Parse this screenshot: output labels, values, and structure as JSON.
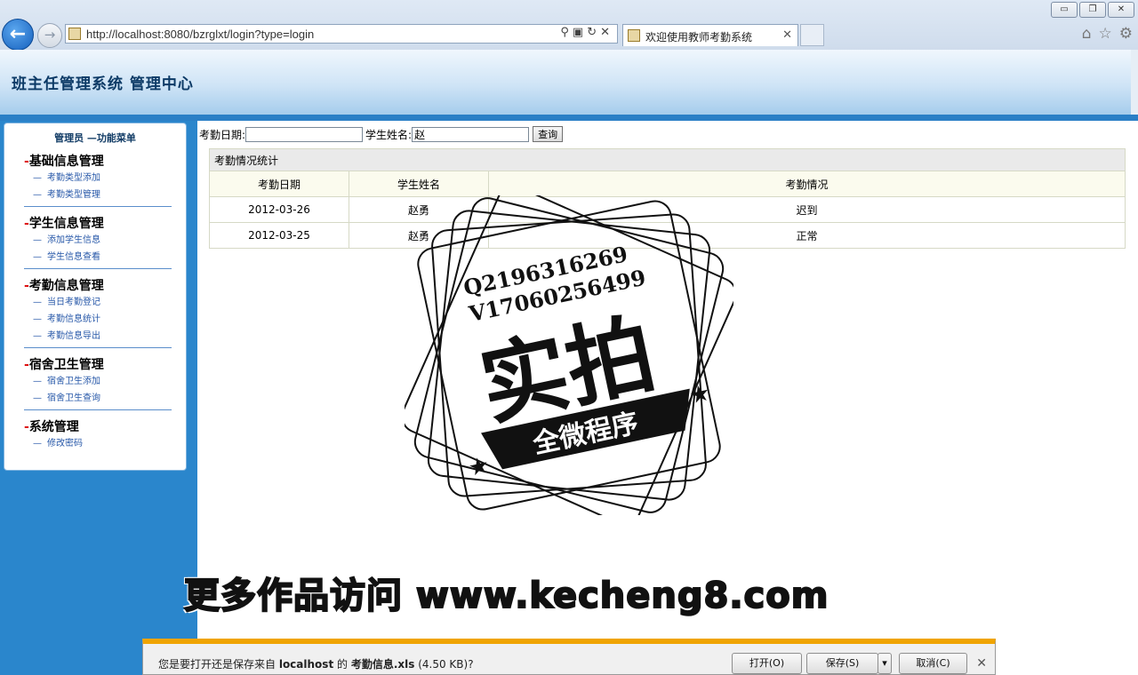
{
  "browser": {
    "url": "http://localhost:8080/bzrglxt/login?type=login",
    "tab_title": "欢迎使用教师考勤系统",
    "window_buttons": [
      "▭",
      "❐",
      "✕"
    ]
  },
  "page": {
    "header_title": "班主任管理系统  管理中心"
  },
  "menu": {
    "heading": "管理员  —功能菜单",
    "groups": [
      {
        "title": "基础信息管理",
        "items": [
          "考勤类型添加",
          "考勤类型管理"
        ]
      },
      {
        "title": "学生信息管理",
        "items": [
          "添加学生信息",
          "学生信息查看"
        ]
      },
      {
        "title": "考勤信息管理",
        "items": [
          "当日考勤登记",
          "考勤信息统计",
          "考勤信息导出"
        ]
      },
      {
        "title": "宿舍卫生管理",
        "items": [
          "宿舍卫生添加",
          "宿舍卫生查询"
        ]
      },
      {
        "title": "系统管理",
        "items": [
          "修改密码"
        ]
      }
    ]
  },
  "search": {
    "date_label": "考勤日期:",
    "date_value": "",
    "name_label": "学生姓名:",
    "name_value": "赵",
    "button_label": "查询"
  },
  "table": {
    "caption": "考勤情况统计",
    "headers": [
      "考勤日期",
      "学生姓名",
      "考勤情况"
    ],
    "rows": [
      [
        "2012-03-26",
        "赵勇",
        "迟到"
      ],
      [
        "2012-03-25",
        "赵勇",
        "正常"
      ]
    ]
  },
  "watermark": {
    "line1": "Q2196316269",
    "line2": "V17060256499",
    "main": "实拍",
    "ribbon": "全微程序",
    "footer": "更多作品访问 www.kecheng8.com"
  },
  "download_bar": {
    "prefix": "您是要打开还是保存来自 ",
    "host": "localhost",
    "middle": " 的 ",
    "filename": "考勤信息.xls",
    "size": " (4.50 KB)?",
    "open_label": "打开(O)",
    "save_label": "保存(S)",
    "save_arrow": "▾",
    "cancel_label": "取消(C)"
  }
}
